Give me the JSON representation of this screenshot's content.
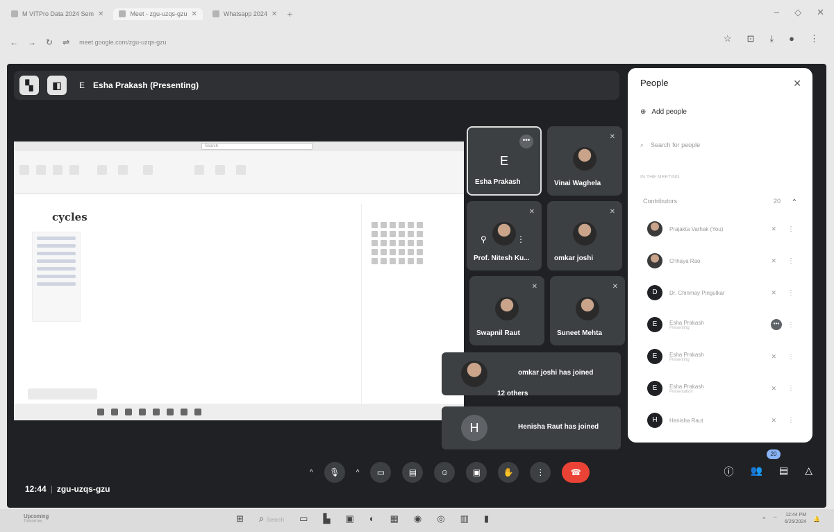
{
  "browser": {
    "tabs": [
      {
        "label": "M VITPro Data 2024 Sem"
      },
      {
        "label": "Meet - zgu-uzqs-gzu"
      },
      {
        "label": "Whatsapp 2024"
      }
    ],
    "url": "meet.google.com/zgu-uzqs-gzu"
  },
  "meet": {
    "presenter_initial": "E",
    "presenter_label": "Esha Prakash (Presenting)",
    "meeting_time": "12:44",
    "meeting_code": "zgu-uzqs-gzu",
    "participant_badge": "20"
  },
  "shared_screen": {
    "logo_text": "cycles",
    "search_placeholder": "Search"
  },
  "tiles": [
    {
      "name": "Esha Prakash",
      "initial": "E"
    },
    {
      "name": "Vinai Waghela"
    },
    {
      "name": "Prof. Nitesh Ku..."
    },
    {
      "name": "omkar joshi"
    },
    {
      "name": "Swapnil Raut"
    },
    {
      "name": "Suneet Mehta"
    }
  ],
  "toasts": [
    {
      "text": "omkar joshi has joined"
    },
    {
      "others": "12 others"
    },
    {
      "initial": "H",
      "text": "Henisha Raut has joined"
    }
  ],
  "people": {
    "title": "People",
    "add_label": "Add people",
    "search_placeholder": "Search for people",
    "section_label": "In the meeting",
    "group_label": "Contributors",
    "group_count": "20",
    "rows": [
      {
        "initial": "",
        "name": "Prajakta Varhak (You)",
        "sub": ""
      },
      {
        "initial": "",
        "name": "Chhaya Rao",
        "sub": ""
      },
      {
        "initial": "D",
        "name": "Dr. Chinmay Pingulkar",
        "sub": ""
      },
      {
        "initial": "E",
        "name": "Esha Prakash",
        "sub": "Presenting"
      },
      {
        "initial": "E",
        "name": "Esha Prakash",
        "sub": "Presenting"
      },
      {
        "initial": "E",
        "name": "Esha Prakash",
        "sub": "Presentation"
      },
      {
        "initial": "H",
        "name": "Henisha Raut",
        "sub": ""
      }
    ]
  },
  "taskbar": {
    "weather_title": "Upcoming",
    "weather_sub": "Tomorrow",
    "search_label": "Search",
    "time": "12:44 PM",
    "date": "6/25/2024"
  }
}
